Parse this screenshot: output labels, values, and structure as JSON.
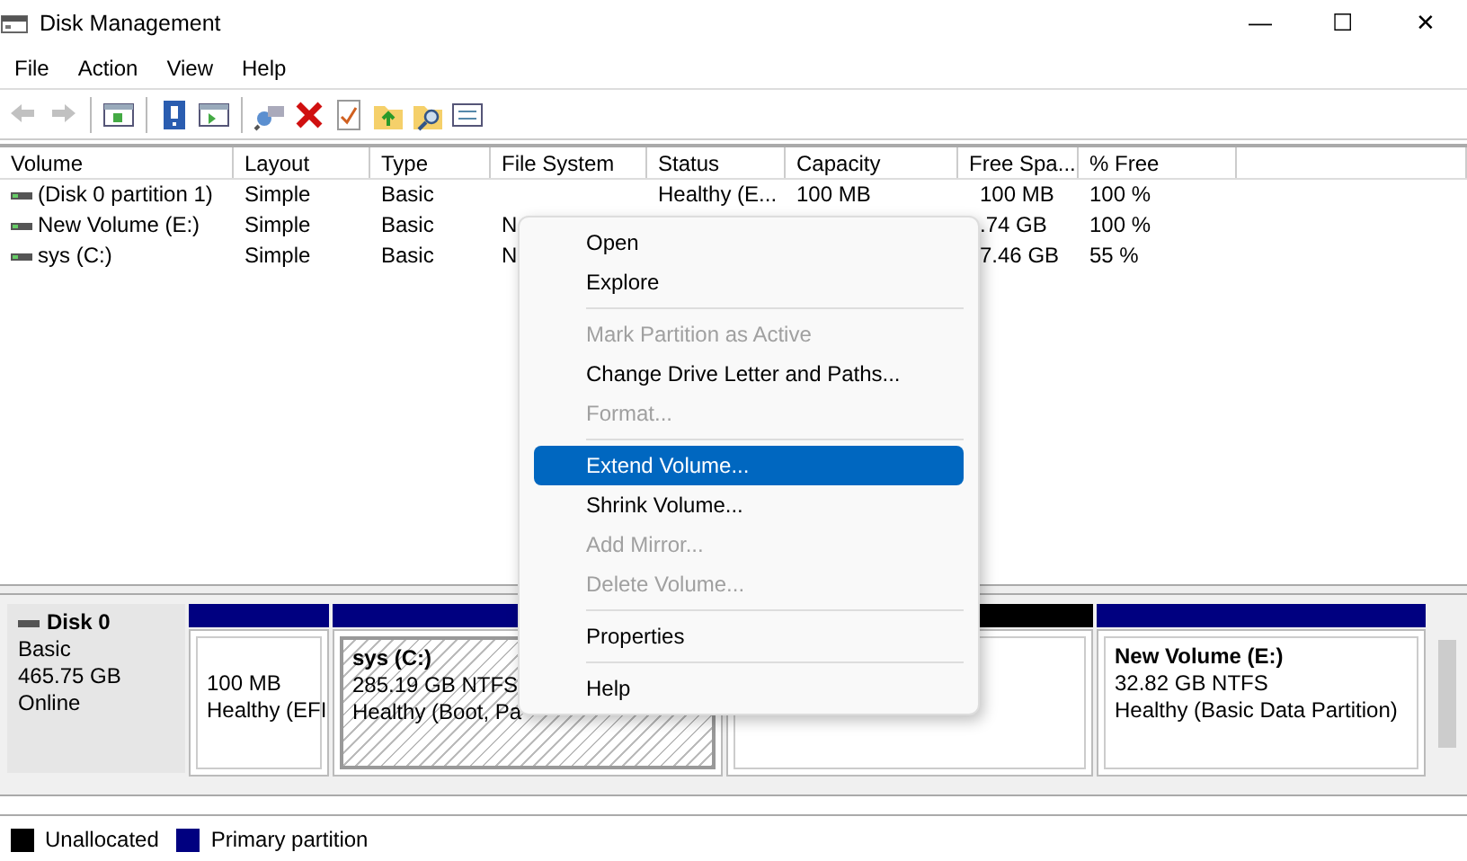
{
  "window": {
    "title": "Disk Management",
    "controls": [
      "—",
      "☐",
      "✕"
    ]
  },
  "menu_bar": [
    "File",
    "Action",
    "View",
    "Help"
  ],
  "toolbar": [
    {
      "kind": "back",
      "disabled": true
    },
    {
      "kind": "forward",
      "disabled": true
    },
    {
      "kind": "sep"
    },
    {
      "kind": "tree"
    },
    {
      "kind": "sep"
    },
    {
      "kind": "help"
    },
    {
      "kind": "panel"
    },
    {
      "kind": "sep"
    },
    {
      "kind": "connect"
    },
    {
      "kind": "delete"
    },
    {
      "kind": "check"
    },
    {
      "kind": "folderup"
    },
    {
      "kind": "foldersearch"
    },
    {
      "kind": "list"
    }
  ],
  "table": {
    "columns": [
      "Volume",
      "Layout",
      "Type",
      "File System",
      "Status",
      "Capacity",
      "Free Spa...",
      "% Free"
    ],
    "rows": [
      {
        "cells": [
          "(Disk 0 partition 1)",
          "Simple",
          "Basic",
          "",
          "Healthy (E...",
          "100 MB",
          "100 MB",
          "100 %"
        ]
      },
      {
        "cells": [
          "New Volume (E:)",
          "Simple",
          "Basic",
          "N",
          "",
          "",
          ".74 GB",
          "100 %"
        ]
      },
      {
        "cells": [
          "sys (C:)",
          "Simple",
          "Basic",
          "N",
          "",
          "",
          "7.46 GB",
          "55 %"
        ]
      }
    ]
  },
  "disks": [
    {
      "name": "Disk 0",
      "type": "Basic",
      "size": "465.75 GB",
      "state": "Online",
      "partitions": [
        {
          "color": "#000080",
          "selected": false,
          "size": "100 MB",
          "status": "Healthy (EFI"
        },
        {
          "color": "#000080",
          "selected": true,
          "name": "sys  (C:)",
          "size": "285.19 GB NTFS",
          "status": "Healthy (Boot, Pa"
        },
        {
          "color": "#000000",
          "selected": false
        },
        {
          "color": "#000080",
          "selected": false,
          "name": "New Volume  (E:)",
          "size": "32.82 GB NTFS",
          "status": "Healthy (Basic Data Partition)"
        }
      ]
    }
  ],
  "legend": [
    {
      "label": "Unallocated",
      "color": "#000000"
    },
    {
      "label": "Primary partition",
      "color": "#000080"
    }
  ],
  "context_menu": [
    {
      "kind": "item",
      "label": "Open",
      "disabled": false,
      "selected": false
    },
    {
      "kind": "item",
      "label": "Explore",
      "disabled": false,
      "selected": false
    },
    {
      "kind": "separator"
    },
    {
      "kind": "item",
      "label": "Mark Partition as Active",
      "disabled": true,
      "selected": false
    },
    {
      "kind": "item",
      "label": "Change Drive Letter and Paths...",
      "disabled": false,
      "selected": false
    },
    {
      "kind": "item",
      "label": "Format...",
      "disabled": true,
      "selected": false
    },
    {
      "kind": "separator"
    },
    {
      "kind": "item",
      "label": "Extend Volume...",
      "disabled": false,
      "selected": true
    },
    {
      "kind": "item",
      "label": "Shrink Volume...",
      "disabled": false,
      "selected": false
    },
    {
      "kind": "item",
      "label": "Add Mirror...",
      "disabled": true,
      "selected": false
    },
    {
      "kind": "item",
      "label": "Delete Volume...",
      "disabled": true,
      "selected": false
    },
    {
      "kind": "separator"
    },
    {
      "kind": "item",
      "label": "Properties",
      "disabled": false,
      "selected": false
    },
    {
      "kind": "separator"
    },
    {
      "kind": "item",
      "label": "Help",
      "disabled": false,
      "selected": false
    }
  ]
}
